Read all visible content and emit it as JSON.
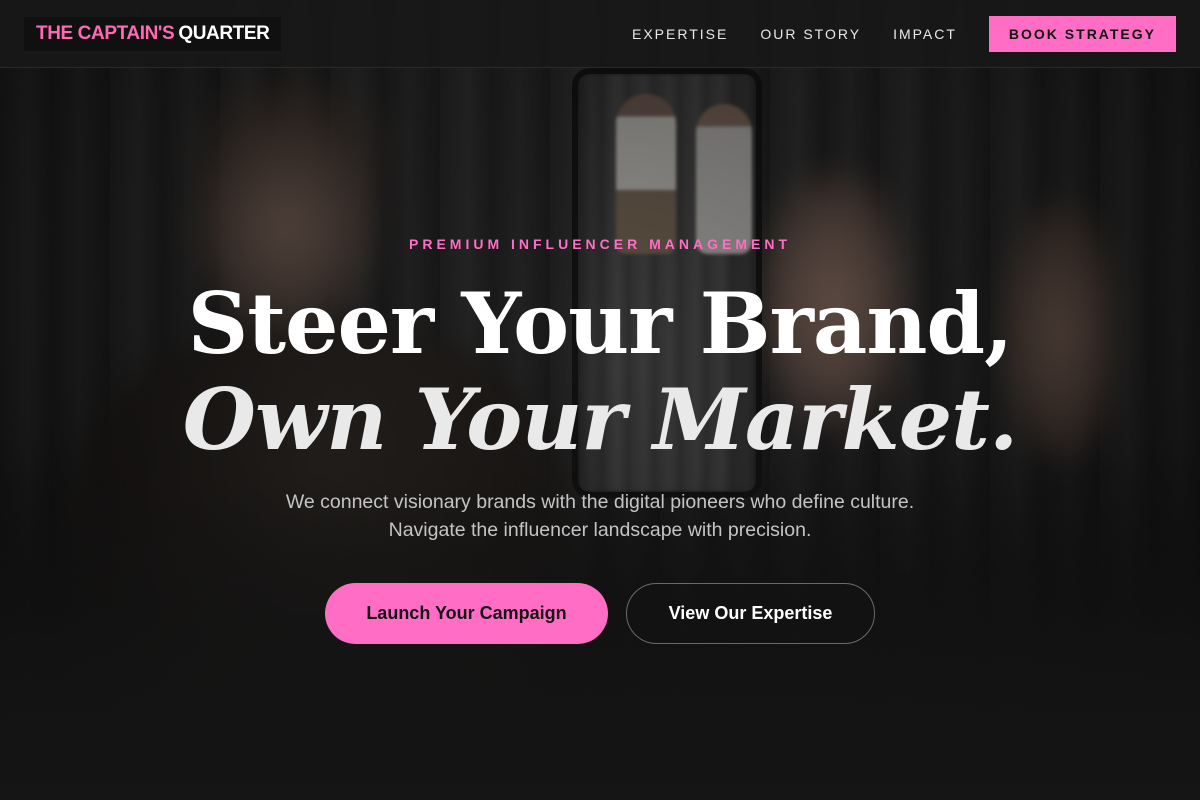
{
  "nav": {
    "brand_accent": "THE CAPTAIN'S",
    "brand_rest": "QUARTER",
    "links": [
      "EXPERTISE",
      "OUR STORY",
      "IMPACT"
    ],
    "cta_label": "BOOK STRATEGY"
  },
  "hero": {
    "eyebrow": "PREMIUM INFLUENCER MANAGEMENT",
    "headline_line1": "Steer Your Brand,",
    "headline_line2": "Own Your Market.",
    "subtitle": "We connect visionary brands with the digital pioneers who define culture. Navigate the influencer landscape with precision.",
    "primary_cta": "Launch Your Campaign",
    "secondary_cta": "View Our Expertise"
  },
  "colors": {
    "accent": "#ff6ec4",
    "background": "#141414",
    "text": "#ffffff"
  }
}
